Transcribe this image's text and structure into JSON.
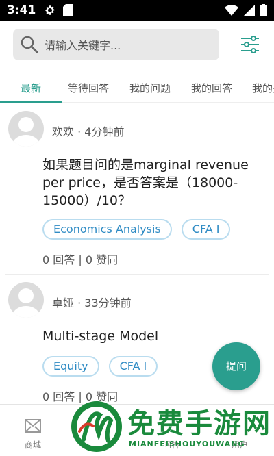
{
  "status_bar": {
    "time": "3:41"
  },
  "search": {
    "placeholder": "请输入关键字..."
  },
  "tabs": [
    {
      "label": "最新",
      "active": true
    },
    {
      "label": "等待回答",
      "active": false
    },
    {
      "label": "我的问题",
      "active": false
    },
    {
      "label": "我的回答",
      "active": false
    },
    {
      "label": "我的关",
      "active": false
    }
  ],
  "posts": [
    {
      "author": "欢欢 · 4分钟前",
      "title": "如果题目问的是marginal revenue per price，是否答案是（18000-15000）/10？",
      "tags": [
        "Economics Analysis",
        "CFA I"
      ],
      "stats": "0 回答 | 0 赞同"
    },
    {
      "author": "卓娅 · 33分钟前",
      "title": "Multi-stage Model",
      "tags": [
        "Equity",
        "CFA I"
      ],
      "stats": "0 回答 | 0 赞同"
    }
  ],
  "ask_button": {
    "label": "提问"
  },
  "bottom_nav": [
    {
      "label": "商城",
      "icon": "store-icon"
    },
    {
      "label": "",
      "icon": "home-icon"
    },
    {
      "label": "",
      "icon": "course-icon"
    },
    {
      "label": "问答",
      "icon": "qa-icon"
    },
    {
      "label": "用户",
      "icon": "user-icon"
    }
  ],
  "watermark": {
    "title": "免费手游网",
    "subtitle": "MIANFEISHOUYOUWANG"
  },
  "colors": {
    "accent": "#2a9e8e",
    "tag_text": "#2e8bc4",
    "tag_border": "#b9dcef"
  }
}
